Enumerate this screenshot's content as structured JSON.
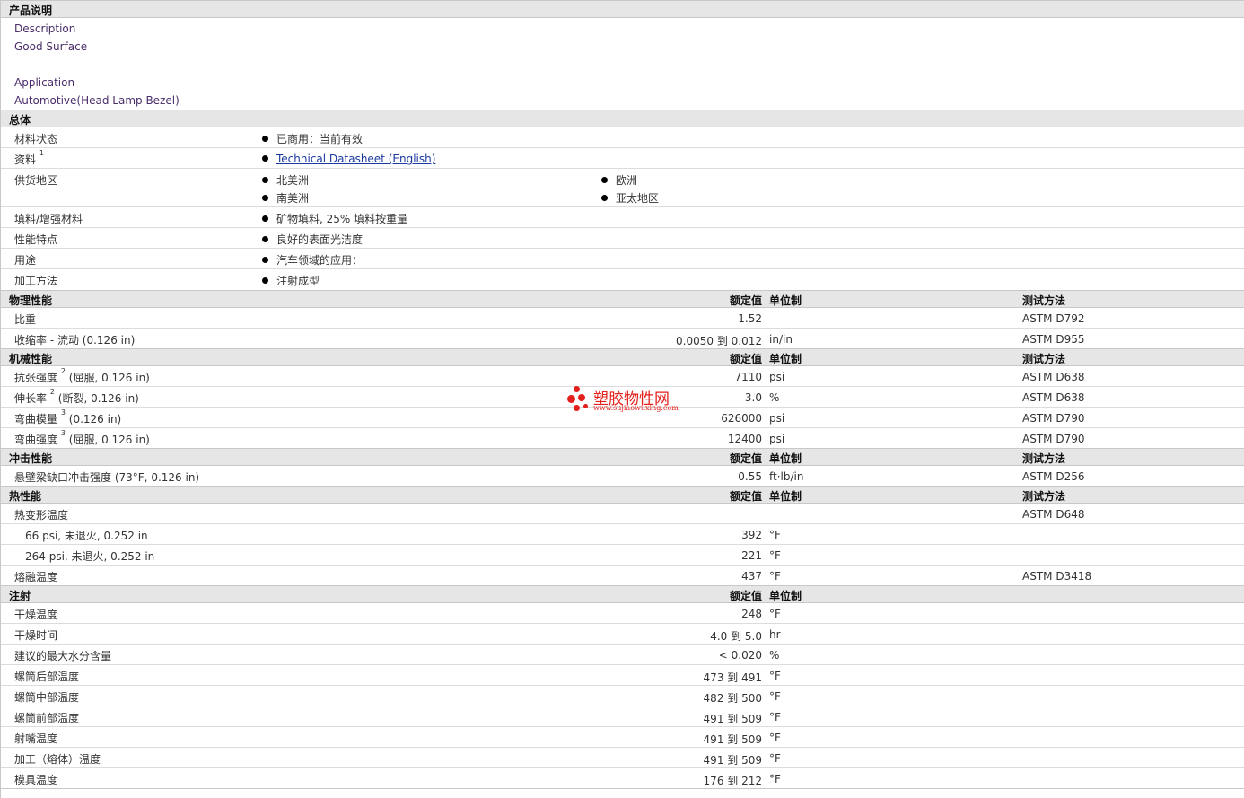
{
  "desc_title": "产品说明",
  "desc_lines": [
    "Description",
    "Good Surface",
    "Application",
    "Automotive(Head Lamp Bezel)"
  ],
  "general": {
    "title": "总体",
    "rows": [
      {
        "label": "材料状态",
        "items": [
          "已商用：当前有效"
        ]
      },
      {
        "label": "资料",
        "sup": "1",
        "link": "Technical Datasheet (English)"
      },
      {
        "label": "供货地区",
        "items": [
          "北美洲",
          "欧洲",
          "南美洲",
          "亚太地区"
        ]
      },
      {
        "label": "填料/增强材料",
        "items": [
          "矿物填料, 25% 填料按重量"
        ]
      },
      {
        "label": "性能特点",
        "items": [
          "良好的表面光洁度"
        ]
      },
      {
        "label": "用途",
        "items": [
          "汽车领域的应用："
        ]
      },
      {
        "label": "加工方法",
        "items": [
          "注射成型"
        ]
      }
    ]
  },
  "headers": {
    "value": "额定值",
    "unit": "单位制",
    "test": "测试方法"
  },
  "physical": {
    "title": "物理性能",
    "rows": [
      {
        "label": "比重",
        "value": "1.52",
        "unit": "",
        "test": "ASTM D792"
      },
      {
        "label": "收缩率",
        "cond": " - 流动  (0.126 in)",
        "value": "0.0050 到  0.012",
        "unit": "in/in",
        "test": "ASTM D955"
      }
    ]
  },
  "mechanical": {
    "title": "机械性能",
    "rows": [
      {
        "label": "抗张强度",
        "sup": "2",
        "cond": "(屈服, 0.126 in)",
        "value": "7110",
        "unit": "psi",
        "test": "ASTM D638"
      },
      {
        "label": "伸长率",
        "sup": "2",
        "cond": "(断裂, 0.126 in)",
        "value": "3.0",
        "unit": "%",
        "test": "ASTM D638"
      },
      {
        "label": "弯曲模量",
        "sup": "3",
        "cond": "(0.126 in)",
        "value": "626000",
        "unit": "psi",
        "test": "ASTM D790"
      },
      {
        "label": "弯曲强度",
        "sup": "3",
        "cond": "(屈服, 0.126 in)",
        "value": "12400",
        "unit": "psi",
        "test": "ASTM D790"
      }
    ]
  },
  "impact": {
    "title": "冲击性能",
    "rows": [
      {
        "label": "悬壁梁缺口冲击强度",
        "cond": "  (73°F, 0.126 in)",
        "value": "0.55",
        "unit": "ft·lb/in",
        "test": "ASTM D256"
      }
    ]
  },
  "thermal": {
    "title": "热性能",
    "rows": [
      {
        "label": "热变形温度",
        "value": "",
        "unit": "",
        "test": "ASTM D648"
      },
      {
        "label": "66 psi, 未退火, 0.252 in",
        "sub": true,
        "value": "392",
        "unit": "°F",
        "test": ""
      },
      {
        "label": "264 psi, 未退火, 0.252 in",
        "sub": true,
        "value": "221",
        "unit": "°F",
        "test": ""
      },
      {
        "label": "熔融温度",
        "value": "437",
        "unit": "°F",
        "test": "ASTM D3418"
      }
    ]
  },
  "injection": {
    "title": "注射",
    "rows": [
      {
        "label": "干燥温度",
        "value": "248",
        "unit": "°F"
      },
      {
        "label": "干燥时间",
        "value": "4.0 到  5.0",
        "unit": "hr"
      },
      {
        "label": "建议的最大水分含量",
        "value": "< 0.020",
        "unit": "%"
      },
      {
        "label": "螺筒后部温度",
        "value": "473 到  491",
        "unit": "°F"
      },
      {
        "label": "螺筒中部温度",
        "value": "482 到  500",
        "unit": "°F"
      },
      {
        "label": "螺筒前部温度",
        "value": "491 到  509",
        "unit": "°F"
      },
      {
        "label": "射嘴温度",
        "value": "491 到  509",
        "unit": "°F"
      },
      {
        "label": "加工（熔体）温度",
        "value": "491 到  509",
        "unit": "°F"
      },
      {
        "label": "模具温度",
        "value": "176 到  212",
        "unit": "°F"
      }
    ]
  },
  "watermark": {
    "cn": "塑胶物性网",
    "en": "www.sujiaowuxing.com",
    "color": "#e3201b"
  }
}
